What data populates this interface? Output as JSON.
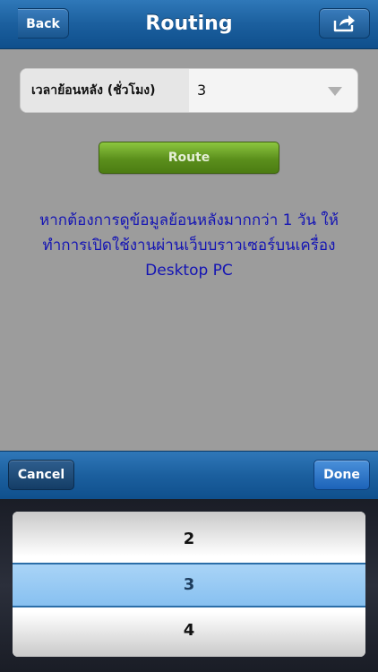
{
  "navbar": {
    "title": "Routing",
    "back_label": "Back",
    "share_icon": "share-icon"
  },
  "form": {
    "field_label": "เวลาย้อนหลัง (ชั่วโมง)",
    "field_value": "3",
    "route_label": "Route"
  },
  "notice": {
    "lines": [
      "หากต้องการดูข้อมูลย้อนหลังมากกว่า 1 วัน ให้",
      "ทำการเปิดใช้งานผ่านเว็บบราวเซอร์บนเครื่อง",
      "Desktop PC"
    ]
  },
  "toolbar": {
    "cancel_label": "Cancel",
    "done_label": "Done"
  },
  "picker": {
    "options": [
      "2",
      "3",
      "4"
    ],
    "selected": "3"
  },
  "colors": {
    "nav_blue": "#1b5f9e",
    "route_green": "#5b8f1c",
    "notice_text": "#1414b4",
    "picker_selection": "#9ccbf4"
  }
}
